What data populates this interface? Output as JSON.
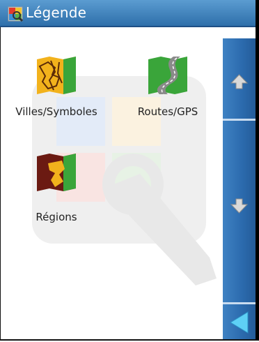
{
  "window": {
    "title": "Légende",
    "title_icon": "legend-map-icon"
  },
  "items": [
    {
      "label": "Villes/Symboles",
      "icon": "cities-map-icon"
    },
    {
      "label": "Routes/GPS",
      "icon": "roads-icon"
    },
    {
      "label": "Régions",
      "icon": "regions-map-icon"
    }
  ],
  "scrollbar": {
    "up_icon": "arrow-up-icon",
    "down_icon": "arrow-down-icon",
    "back_icon": "back-arrow-icon"
  },
  "colors": {
    "titlebar": "#3d82c0",
    "scrollbar": "#2f6fb0",
    "text": "#222222"
  }
}
